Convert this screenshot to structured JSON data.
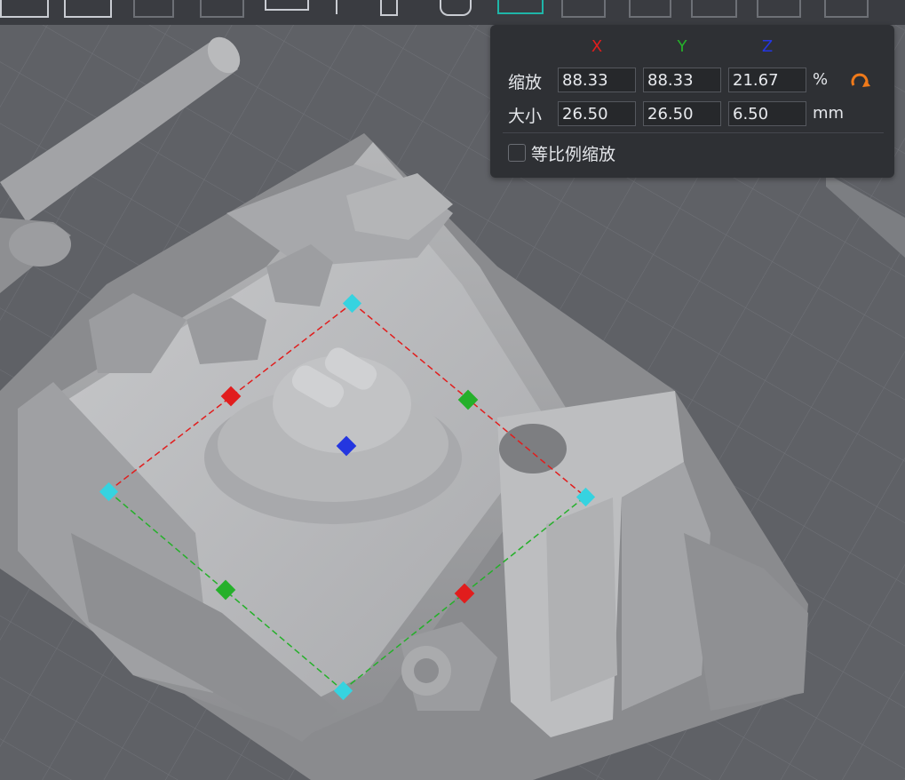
{
  "toolbar": {
    "buttons": [
      "auto-arrange-icon",
      "layout-icon",
      "undo-icon",
      "copy-icon",
      "align-icon",
      "drop-to-plate-icon",
      "lay-flat-icon",
      "scale-tool-icon",
      "split-icon",
      "plate-icon",
      "clone-icon",
      "texture-icon",
      "cube-icon"
    ]
  },
  "scale_panel": {
    "axes": {
      "x": "X",
      "y": "Y",
      "z": "Z"
    },
    "axis_colors": {
      "x": "#e11d1d",
      "y": "#25b02a",
      "z": "#2436e0"
    },
    "scale": {
      "label": "缩放",
      "x": "88.33",
      "y": "88.33",
      "z": "21.67",
      "unit": "%"
    },
    "size": {
      "label": "大小",
      "x": "26.50",
      "y": "26.50",
      "z": "6.50",
      "unit": "mm"
    },
    "uniform_scale": {
      "label": "等比例缩放",
      "checked": false
    },
    "reset_icon": "rotate-reset-icon",
    "accent": "#f07a1a"
  }
}
